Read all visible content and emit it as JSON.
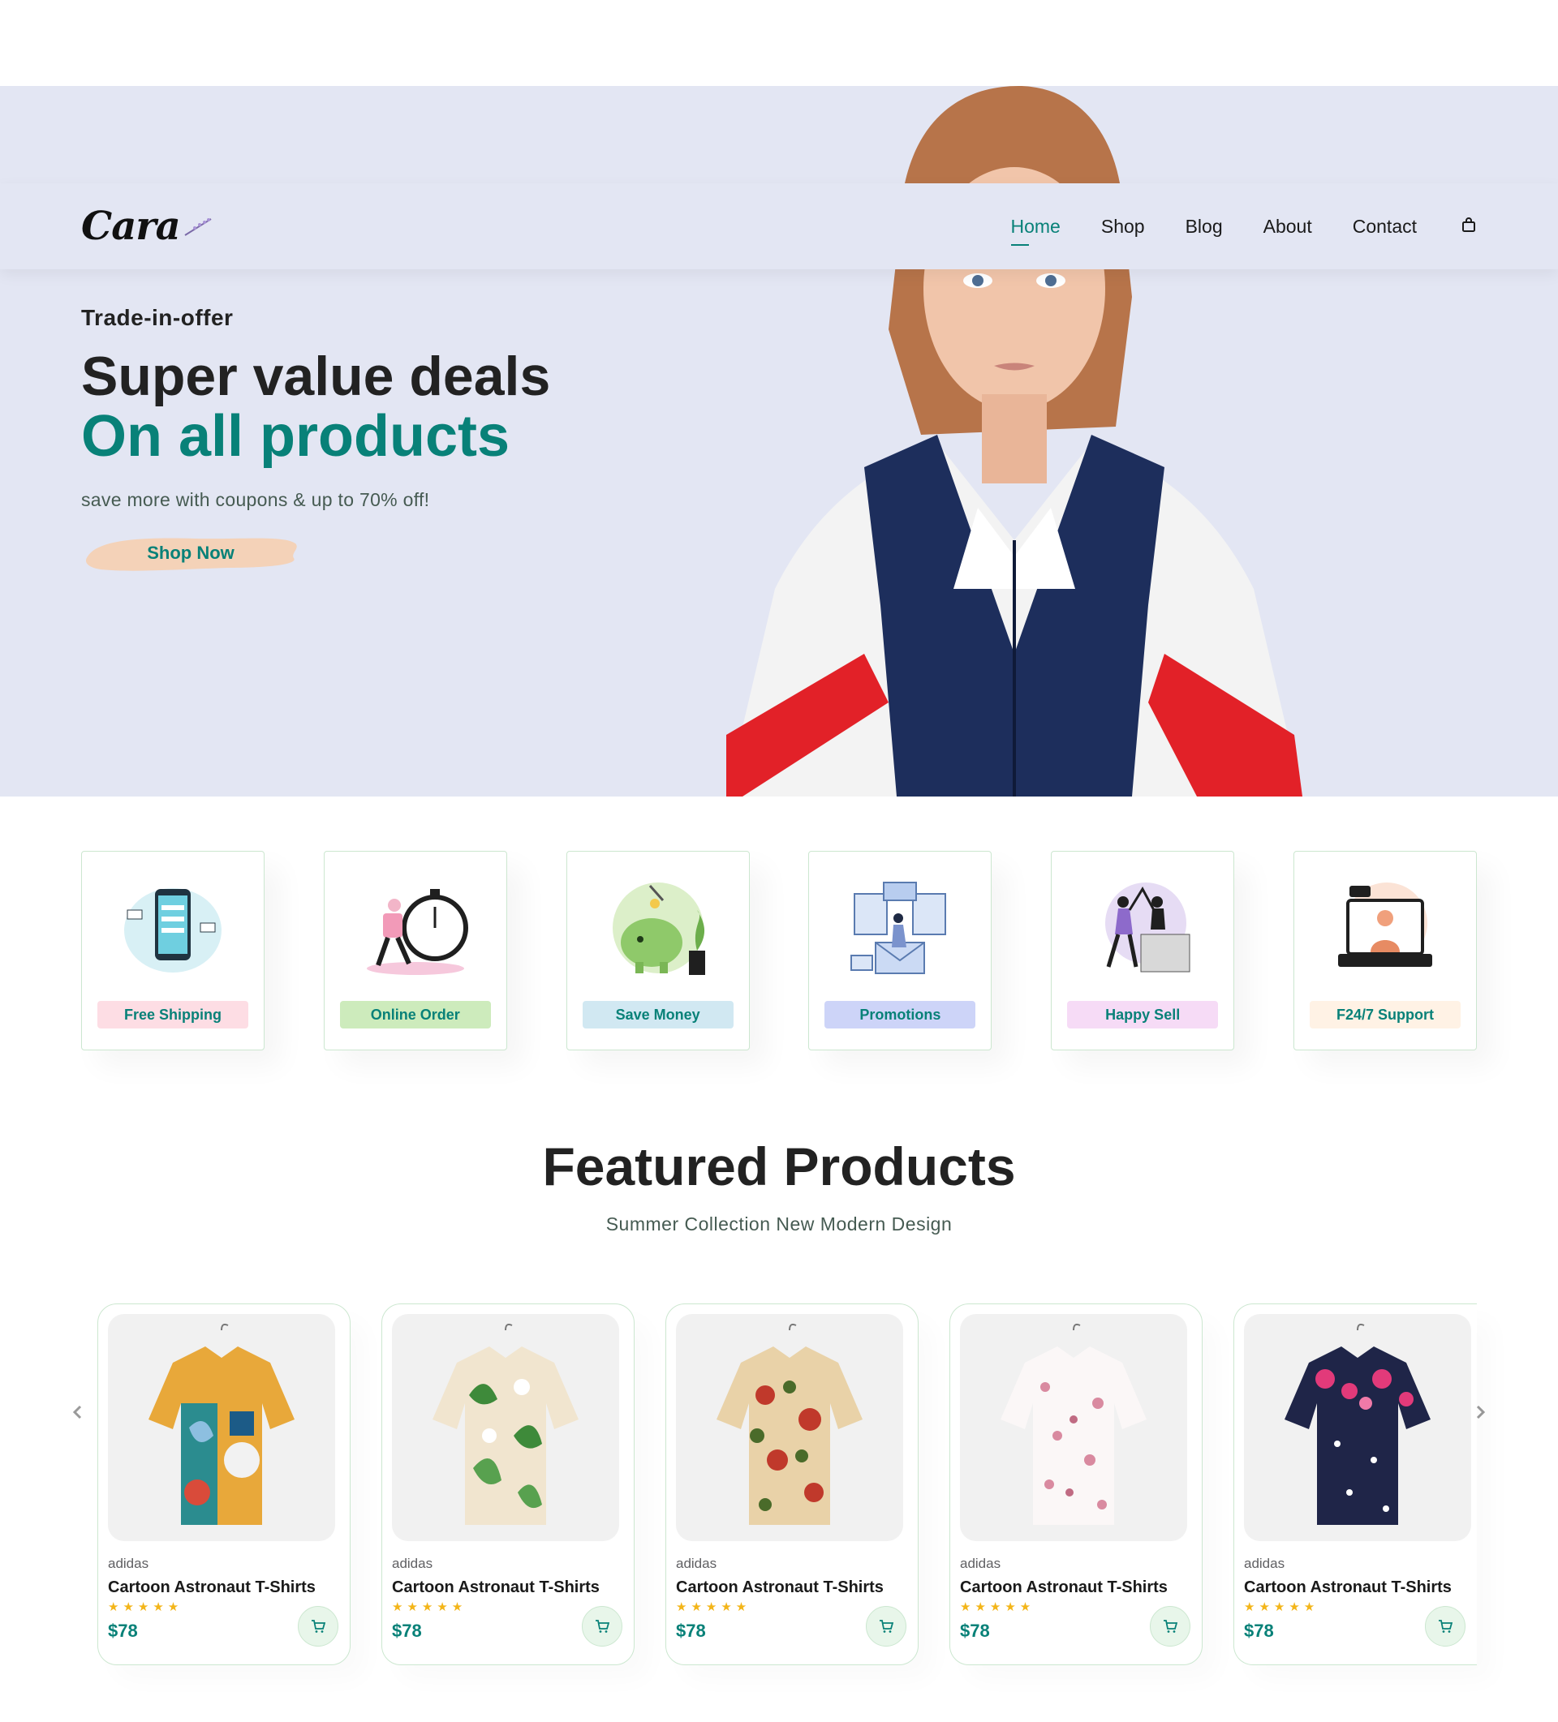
{
  "brand": {
    "logo_text": "Cara"
  },
  "nav": {
    "items": [
      {
        "label": "Home",
        "active": true
      },
      {
        "label": "Shop",
        "active": false
      },
      {
        "label": "Blog",
        "active": false
      },
      {
        "label": "About",
        "active": false
      },
      {
        "label": "Contact",
        "active": false
      }
    ],
    "cart_icon": "shopping-bag-icon"
  },
  "hero": {
    "kicker": "Trade-in-offer",
    "headline": "Super value deals",
    "headline_accent": "On all products",
    "subtext": "save more with coupons & up to 70% off!",
    "cta_label": "Shop Now"
  },
  "features": [
    {
      "label": "Free Shipping",
      "bg": "#fddde4",
      "icon": "phone-payment-illustration"
    },
    {
      "label": "Online Order",
      "bg": "#cdebbc",
      "icon": "stopwatch-runner-illustration"
    },
    {
      "label": "Save Money",
      "bg": "#d1e8f2",
      "icon": "piggy-bank-illustration"
    },
    {
      "label": "Promotions",
      "bg": "#cdd4f8",
      "icon": "promotion-envelope-illustration"
    },
    {
      "label": "Happy Sell",
      "bg": "#f6dbf6",
      "icon": "high-five-illustration"
    },
    {
      "label": "F24/7 Support",
      "bg": "#fff2e5",
      "icon": "laptop-support-illustration"
    }
  ],
  "featured": {
    "title": "Featured Products",
    "subtitle": "Summer Collection New Modern Design",
    "products": [
      {
        "brand": "adidas",
        "name": "Cartoon Astronaut T-Shirts",
        "stars": "★★★★★",
        "price": "$78",
        "image": "abstract-print-shirt"
      },
      {
        "brand": "adidas",
        "name": "Cartoon Astronaut T-Shirts",
        "stars": "★★★★★",
        "price": "$78",
        "image": "leaf-print-shirt"
      },
      {
        "brand": "adidas",
        "name": "Cartoon Astronaut T-Shirts",
        "stars": "★★★★★",
        "price": "$78",
        "image": "floral-print-shirt"
      },
      {
        "brand": "adidas",
        "name": "Cartoon Astronaut T-Shirts",
        "stars": "★★★★★",
        "price": "$78",
        "image": "white-blossom-shirt"
      },
      {
        "brand": "adidas",
        "name": "Cartoon Astronaut T-Shirts",
        "stars": "★★★★★",
        "price": "$78",
        "image": "navy-floral-shirt"
      }
    ]
  },
  "colors": {
    "accent": "#088178",
    "hero_bg": "#e3e6f3",
    "star": "#f3b519",
    "button_brush": "#f4d2b8"
  }
}
